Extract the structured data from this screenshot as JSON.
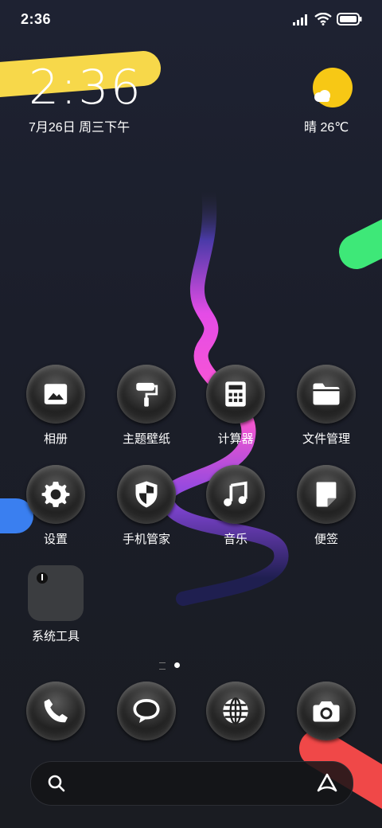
{
  "status_bar": {
    "time": "2:36",
    "icons": [
      "signal-icon",
      "wifi-icon",
      "battery-icon"
    ]
  },
  "lockclock": {
    "time": "2:36",
    "date": "7月26日 周三下午"
  },
  "weather": {
    "text": "晴 26℃",
    "icon": "sun-cloud-icon"
  },
  "apps_row1": [
    {
      "label": "相册",
      "icon": "gallery-icon"
    },
    {
      "label": "主题壁纸",
      "icon": "paint-roller-icon"
    },
    {
      "label": "计算器",
      "icon": "calculator-icon"
    },
    {
      "label": "文件管理",
      "icon": "folder-icon"
    }
  ],
  "apps_row2": [
    {
      "label": "设置",
      "icon": "gear-icon"
    },
    {
      "label": "手机管家",
      "icon": "shield-icon"
    },
    {
      "label": "音乐",
      "icon": "music-note-icon"
    },
    {
      "label": "便签",
      "icon": "note-icon"
    }
  ],
  "folder": {
    "label": "系统工具"
  },
  "dock": [
    {
      "name": "phone",
      "icon": "phone-icon"
    },
    {
      "name": "messages",
      "icon": "chat-bubble-icon"
    },
    {
      "name": "browser",
      "icon": "globe-icon"
    },
    {
      "name": "camera",
      "icon": "camera-icon"
    }
  ],
  "search": {
    "left_icon": "search-icon",
    "right_icon": "assistant-icon"
  },
  "colors": {
    "yellow": "#f7d84a",
    "green": "#3ee878",
    "blue": "#3a7ff0",
    "red": "#f04848",
    "magenta": "#e040e0",
    "purple": "#6b3ee0"
  }
}
